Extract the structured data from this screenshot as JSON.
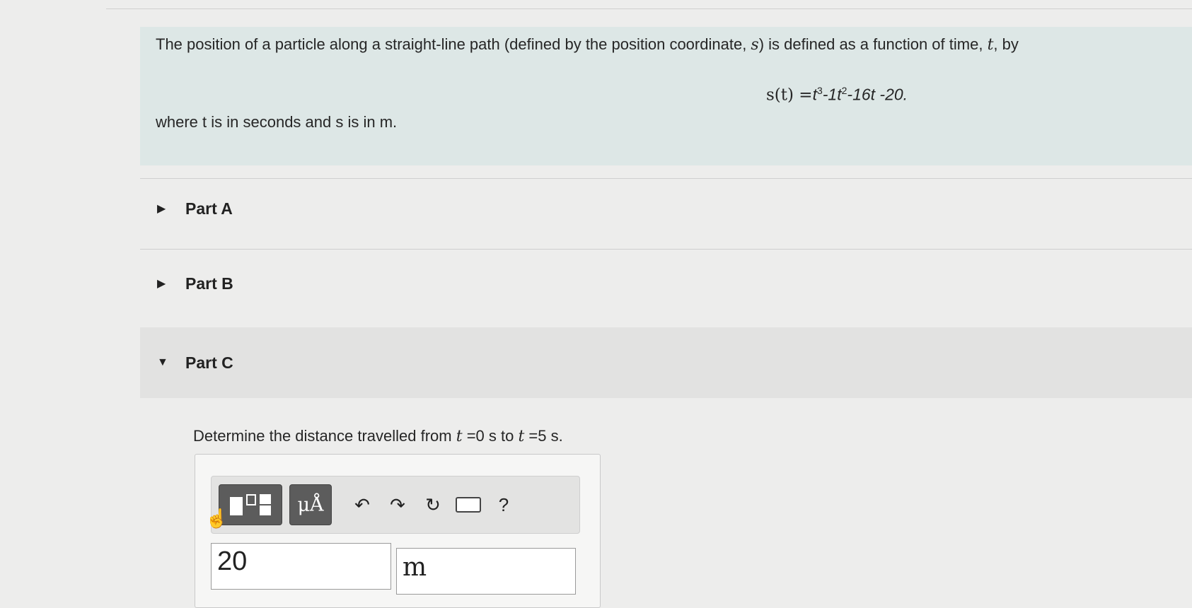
{
  "problem": {
    "intro_pre": "The position of a particle along a straight-line path (defined by the position coordinate, ",
    "intro_var_s": "s",
    "intro_mid": ") is defined as a function of time, ",
    "intro_var_t": "t",
    "intro_post": ",  by",
    "equation_lhs": "s(t) =",
    "eq_term1": "t",
    "eq_exp1": "3",
    "eq_term2": "-1t",
    "eq_exp2": "2",
    "eq_rest": "-16t -20.",
    "where_text": "where t is in seconds and s is in m."
  },
  "parts": [
    {
      "caret": "▶",
      "label": "Part A"
    },
    {
      "caret": "▶",
      "label": "Part B"
    },
    {
      "caret": "▼",
      "label": "Part C"
    }
  ],
  "question": {
    "pre": "Determine the distance travelled from ",
    "t1": "t",
    "eq1": " =0 s to ",
    "t2": "t",
    "eq2": " =5 s."
  },
  "toolbar": {
    "units_label": "μÅ",
    "undo_icon": "↶",
    "redo_icon": "↷",
    "reset_icon": "↻",
    "help_label": "?"
  },
  "answer": {
    "value": "20",
    "unit": "m"
  }
}
